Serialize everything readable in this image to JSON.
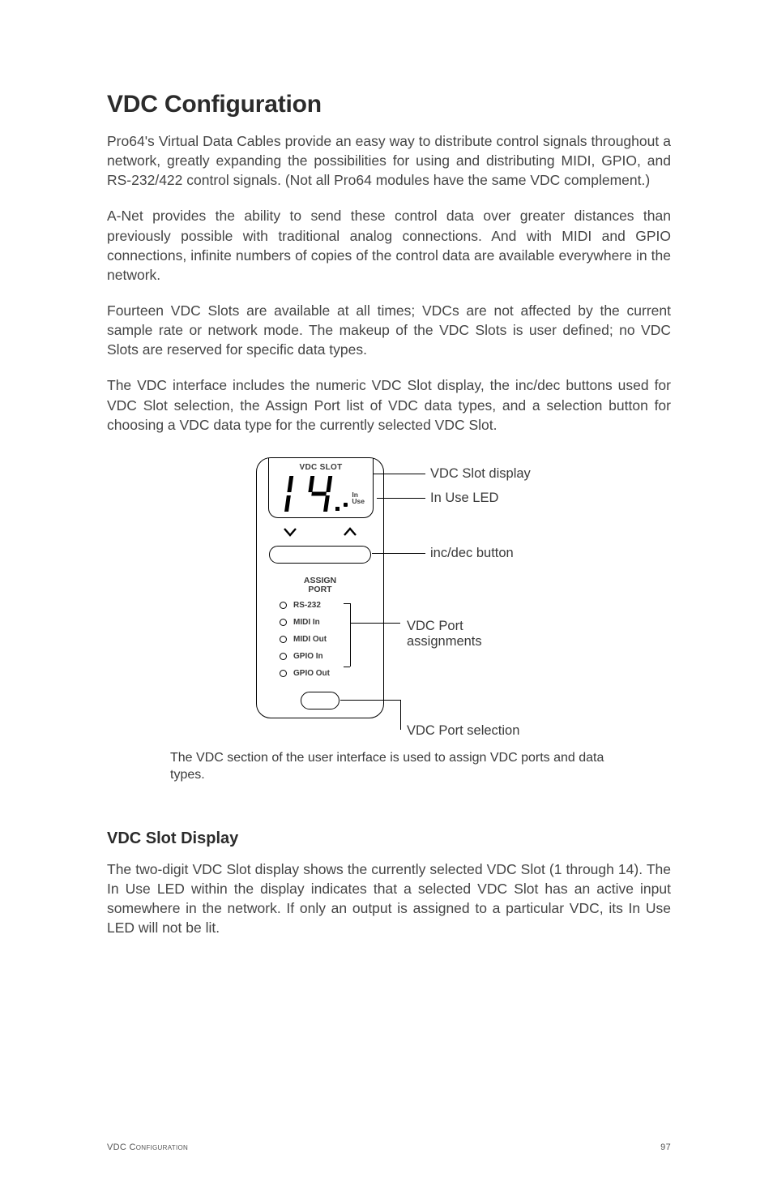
{
  "title": "VDC Configuration",
  "paragraphs": {
    "p1": "Pro64's Virtual Data Cables provide an easy way to distribute control signals throughout a network, greatly expanding the possibilities for using and distributing MIDI, GPIO, and RS-232/422 control signals. (Not all Pro64 modules have the same VDC complement.)",
    "p2": "A-Net provides the ability to send these control data over greater distances than previously possible with traditional analog connections. And with MIDI and GPIO connections, infinite numbers of copies of the control data are available everywhere in the network.",
    "p3": "Fourteen VDC Slots are available at all times; VDCs are not affected by the current sample rate or network mode. The makeup of the VDC Slots is user defined; no VDC Slots are reserved for specific data types.",
    "p4": "The VDC interface includes the numeric VDC Slot display, the inc/dec buttons used for VDC Slot selection, the Assign Port list of VDC data types, and a selection button for choosing a VDC data type for the currently selected VDC Slot."
  },
  "diagram": {
    "slot_label": "VDC SLOT",
    "in_use_line1": "In",
    "in_use_line2": "Use",
    "assign_line1": "ASSIGN",
    "assign_line2": "PORT",
    "options": [
      "RS-232",
      "MIDI In",
      "MIDI Out",
      "GPIO In",
      "GPIO Out"
    ],
    "callouts": {
      "slot_display": "VDC Slot display",
      "in_use_led": "In Use LED",
      "inc_dec": "inc/dec button",
      "vdc_port_line1": "VDC Port",
      "vdc_port_line2": "assignments",
      "port_selection": "VDC Port selection"
    }
  },
  "caption": "The VDC section of the user interface is used to assign VDC ports and data types.",
  "subhead": "VDC Slot Display",
  "p5": "The two-digit VDC Slot display shows the currently selected VDC Slot (1 through 14). The In Use LED within the display indicates that a selected VDC Slot has an active input somewhere in the network. If only an output is assigned to a particular VDC, its In Use LED will not be lit.",
  "footer": {
    "section": "VDC Configuration",
    "page": "97"
  }
}
